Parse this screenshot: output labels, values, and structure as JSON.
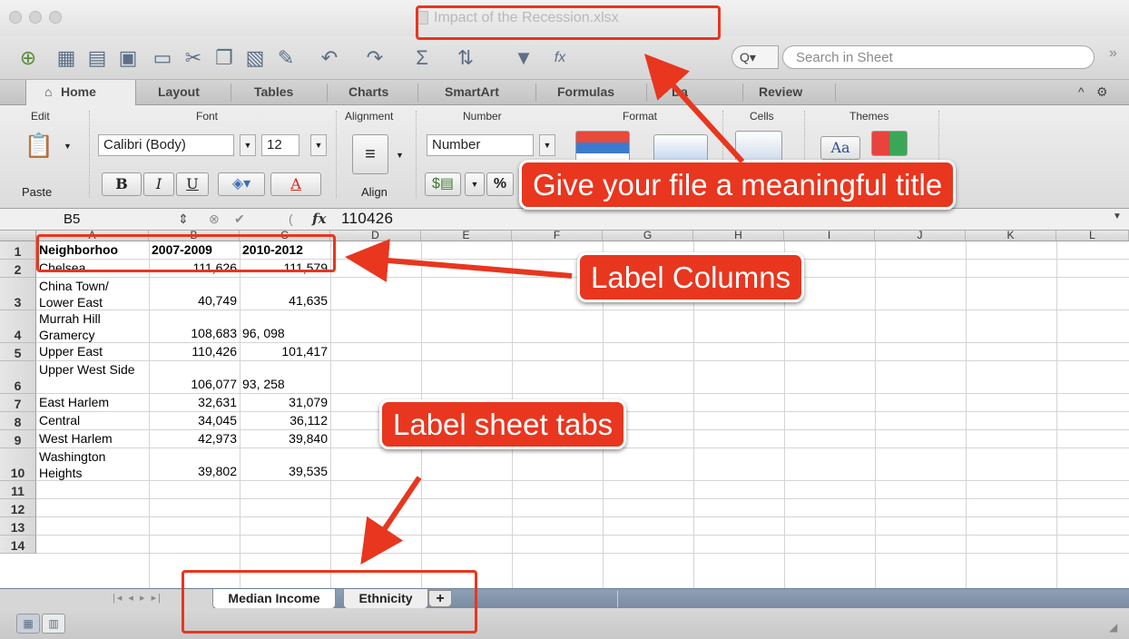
{
  "window": {
    "title": "Impact of the Recession.xlsx"
  },
  "toolbar": {
    "icons": [
      "new-workbook-icon",
      "templates-icon",
      "open-icon",
      "save-icon",
      "print-icon",
      "cut-icon",
      "copy-icon",
      "paste-icon",
      "format-painter-icon",
      "undo-icon",
      "redo-icon",
      "autosum-icon",
      "sort-icon",
      "filter-icon",
      "formula-builder-icon"
    ],
    "search_dropdown": "Q▾",
    "search_placeholder": "Search in Sheet"
  },
  "ribbon": {
    "tabs": [
      "Home",
      "Layout",
      "Tables",
      "Charts",
      "SmartArt",
      "Formulas",
      "Da",
      "Review"
    ],
    "groups": {
      "edit": "Edit",
      "font": "Font",
      "alignment": "Alignment",
      "number": "Number",
      "format": "Format",
      "cells": "Cells",
      "themes": "Themes"
    },
    "paste_label": "Paste",
    "font_name": "Calibri (Body)",
    "font_size": "12",
    "bold": "B",
    "italic": "I",
    "underline": "U",
    "font_color": "A",
    "align_label": "Align",
    "number_format": "Number",
    "percent": "%",
    "themes_aa": "Aa"
  },
  "formula_bar": {
    "name_box": "B5",
    "fx": "fx",
    "value": "110426"
  },
  "sheet": {
    "columns": [
      "A",
      "B",
      "C",
      "D",
      "E",
      "F",
      "G",
      "H",
      "I",
      "J",
      "K",
      "L"
    ],
    "rows": [
      {
        "num": "1",
        "a": "Neighborhoo",
        "b": "2007-2009",
        "c": "2010-2012"
      },
      {
        "num": "2",
        "a": "Chelsea",
        "b": "111,626",
        "c": "111,579"
      },
      {
        "num": "3",
        "a": "China Town/ Lower East",
        "b": "40,749",
        "c": "41,635"
      },
      {
        "num": "4",
        "a": "Murrah Hill Gramercy",
        "b": "108,683",
        "c": "96, 098"
      },
      {
        "num": "5",
        "a": "Upper East",
        "b": "110,426",
        "c": "101,417"
      },
      {
        "num": "6",
        "a": "Upper West Side",
        "b": "106,077",
        "c": "93, 258"
      },
      {
        "num": "7",
        "a": "East Harlem",
        "b": "32,631",
        "c": "31,079"
      },
      {
        "num": "8",
        "a": "Central",
        "b": "34,045",
        "c": "36,112"
      },
      {
        "num": "9",
        "a": "West Harlem",
        "b": "42,973",
        "c": "39,840"
      },
      {
        "num": "10",
        "a": "Washington Heights",
        "b": "39,802",
        "c": "39,535"
      },
      {
        "num": "11",
        "a": "",
        "b": "",
        "c": ""
      },
      {
        "num": "12",
        "a": "",
        "b": "",
        "c": ""
      },
      {
        "num": "13",
        "a": "",
        "b": "",
        "c": ""
      },
      {
        "num": "14",
        "a": "",
        "b": "",
        "c": ""
      }
    ],
    "tabs": [
      "Median Income",
      "Ethnicity"
    ],
    "add_tab": "+",
    "nav_arrows": "|◂ ◂ ▸ ▸|"
  },
  "annotations": {
    "title_callout": "Give your file a meaningful title",
    "columns_callout": "Label Columns",
    "tabs_callout": "Label sheet tabs",
    "color": "#e8361f"
  }
}
